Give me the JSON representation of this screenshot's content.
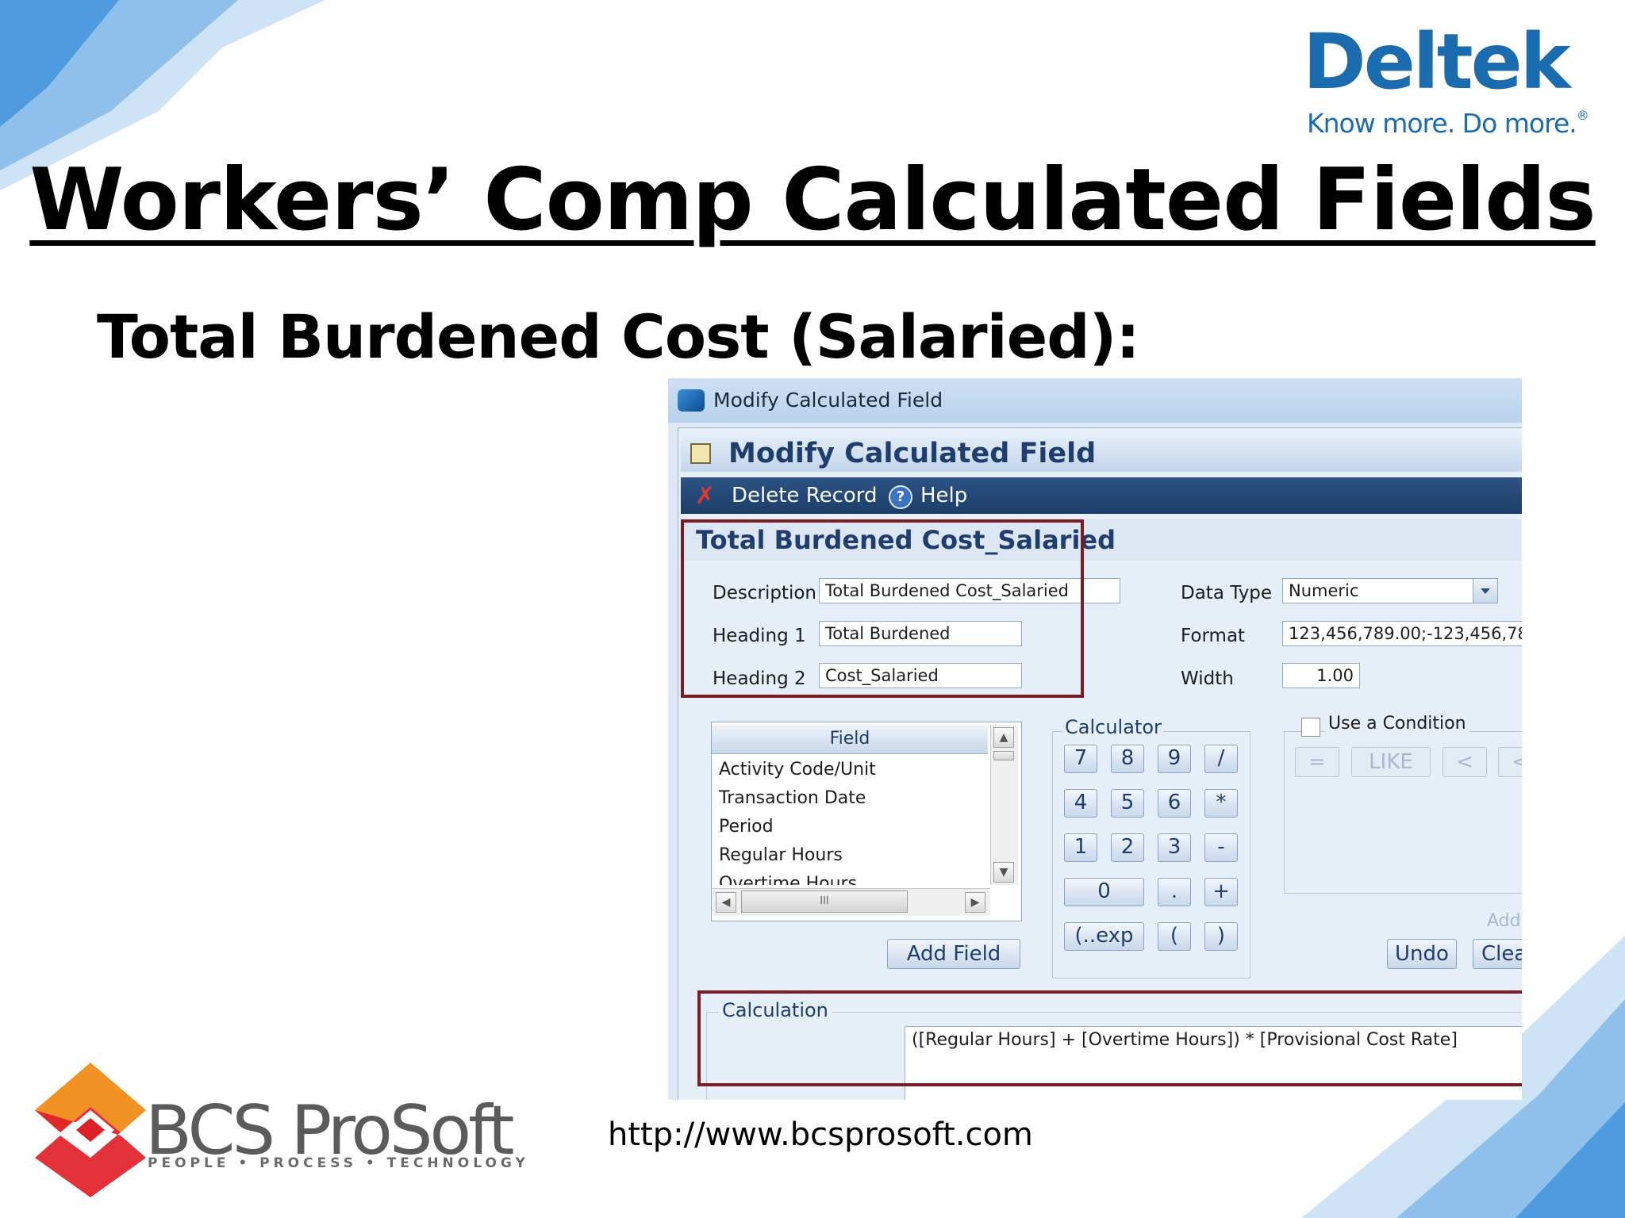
{
  "slide": {
    "title": "Workers’ Comp Calculated Fields",
    "subtitle": "Total Burdened Cost (Salaried):",
    "website": "http://www.bcsprosoft.com",
    "accent_color": "#1a6cae"
  },
  "logos": {
    "deltek": {
      "name": "Deltek",
      "tagline": "Know more. Do more.",
      "registered": "®"
    },
    "bcs": {
      "name": "BCS ProSoft",
      "tagline": "PEOPLE • PROCESS • TECHNOLOGY"
    }
  },
  "window": {
    "title": "Modify Calculated Field",
    "header_title": "Modify Calculated Field",
    "toolbar": {
      "delete_label": "Delete Record",
      "help_label": "Help"
    },
    "record_title": "Total Burdened Cost_Salaried",
    "form": {
      "description": {
        "label": "Description",
        "value": "Total Burdened Cost_Salaried"
      },
      "heading1": {
        "label": "Heading 1",
        "value": "Total Burdened"
      },
      "heading2": {
        "label": "Heading 2",
        "value": "Cost_Salaried"
      },
      "data_type": {
        "label": "Data Type",
        "value": "Numeric"
      },
      "format": {
        "label": "Format",
        "value": "123,456,789.00;-123,456,78"
      },
      "width": {
        "label": "Width",
        "value": "1.00"
      }
    },
    "field_list": {
      "header": "Field",
      "items": [
        "Activity Code/Unit",
        "Transaction Date",
        "Period",
        "Regular Hours",
        "Overtime Hours"
      ],
      "add_field_label": "Add Field",
      "hscroll_grip": "III"
    },
    "calculator": {
      "label": "Calculator",
      "keys": [
        [
          "7",
          "8",
          "9",
          "/"
        ],
        [
          "4",
          "5",
          "6",
          "*"
        ],
        [
          "1",
          "2",
          "3",
          "-"
        ],
        [
          "0",
          ".",
          "+"
        ],
        [
          "(..exp",
          "(",
          ")"
        ]
      ]
    },
    "condition": {
      "label": "Use a Condition",
      "checked": false,
      "buttons": [
        "=",
        "LIKE",
        "<",
        "<"
      ],
      "add_label": "Add"
    },
    "undo_label": "Undo",
    "clear_label": "Clea",
    "calculation": {
      "label": "Calculation",
      "expression": "([Regular Hours] + [Overtime Hours]) * [Provisional Cost Rate]"
    }
  }
}
